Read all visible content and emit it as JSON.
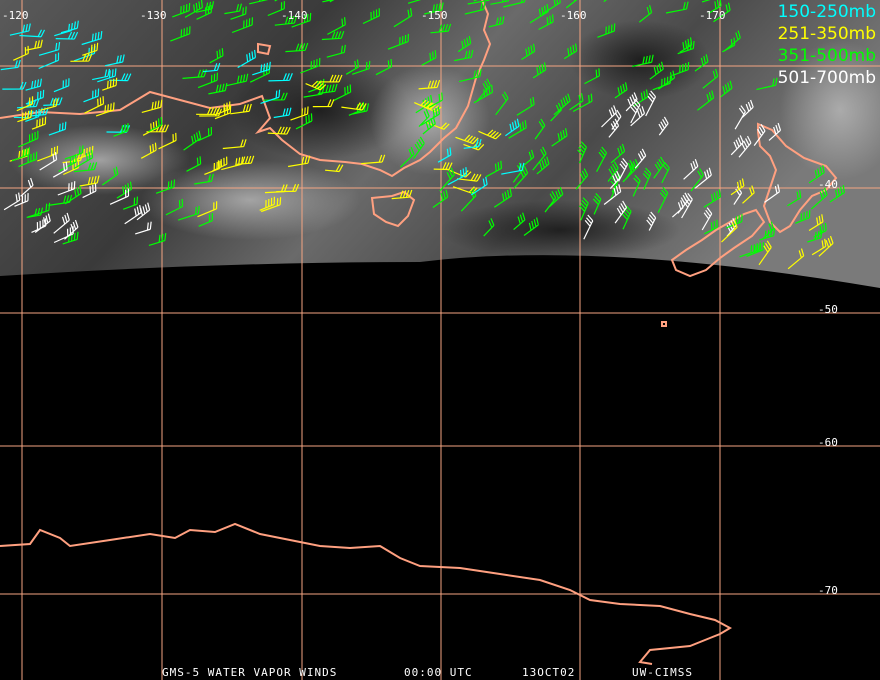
{
  "map": {
    "longitude_labels": [
      "-120",
      "-130",
      "-140",
      "-150",
      "-160",
      "-170"
    ],
    "latitude_labels": [
      "-40",
      "-50",
      "-60",
      "-70"
    ],
    "grid_color": "#f4a582",
    "coast_color": "#ffa080"
  },
  "legend": [
    {
      "text": "150-250mb",
      "color": "#00ffff"
    },
    {
      "text": "251-350mb",
      "color": "#ffff00"
    },
    {
      "text": "351-500mb",
      "color": "#00ff00"
    },
    {
      "text": "501-700mb",
      "color": "#ffffff"
    }
  ],
  "footer": {
    "product": "GMS-5 WATER VAPOR WINDS",
    "time": "00:00 UTC",
    "date": "13OCT02",
    "source": "UW-CIMSS"
  }
}
